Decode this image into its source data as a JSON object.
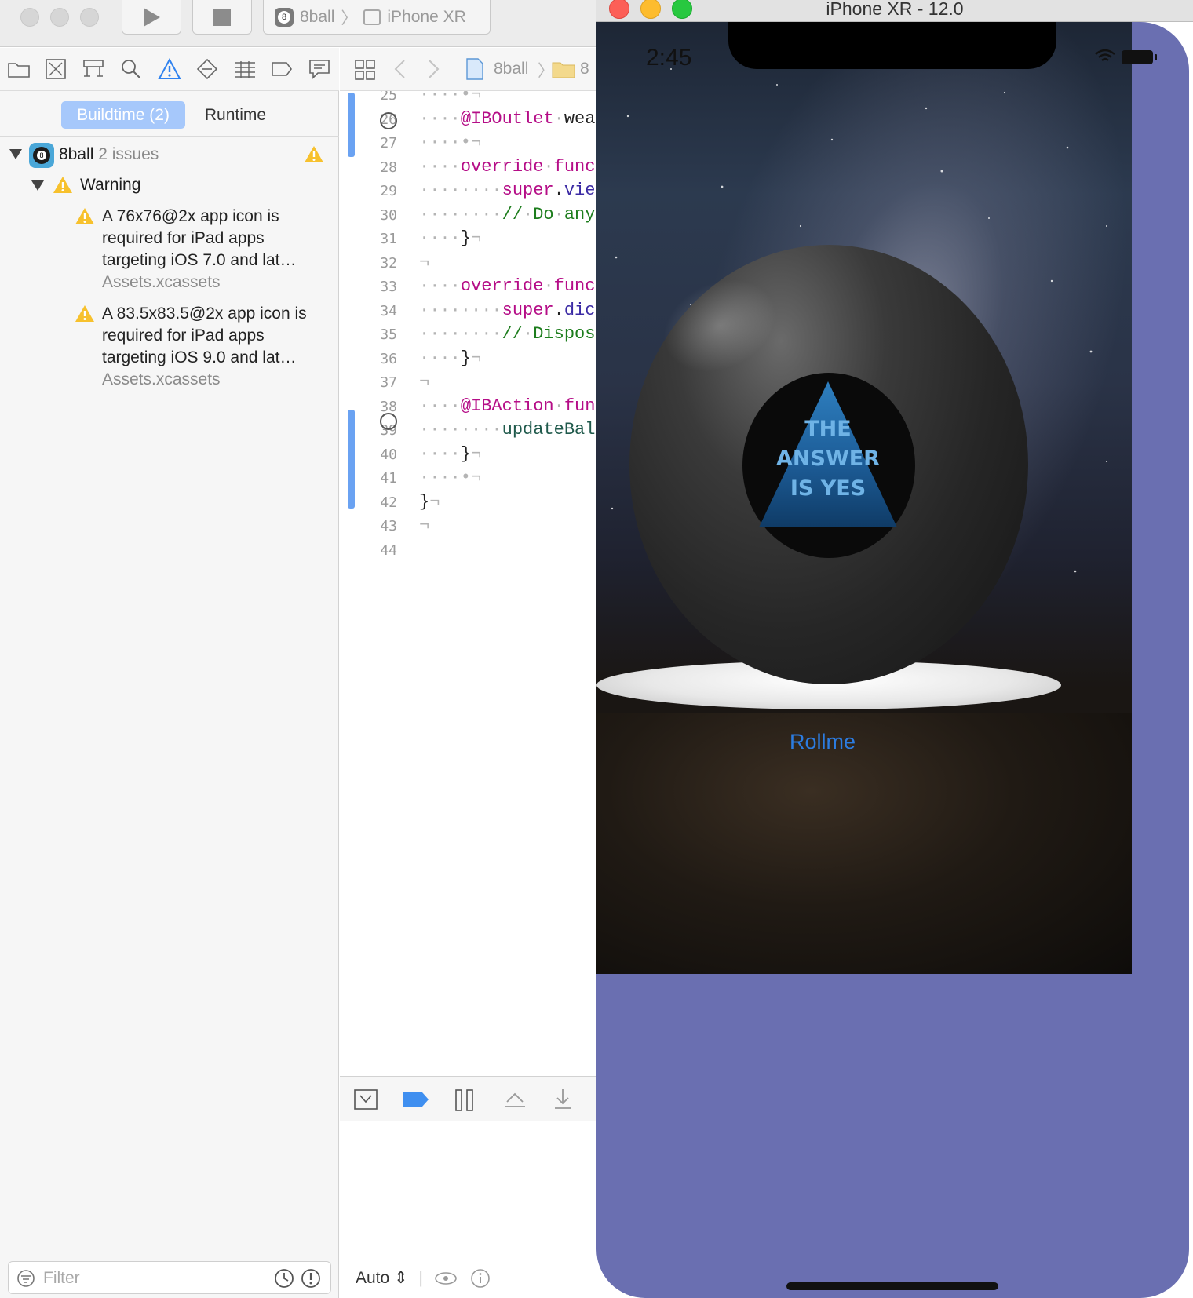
{
  "toolbar": {
    "scheme_project": "8ball",
    "scheme_device": "iPhone XR"
  },
  "navigator": {
    "segments": {
      "active": "Buildtime (2)",
      "inactive": "Runtime"
    },
    "project": {
      "name": "8ball",
      "issue_count": "2 issues"
    },
    "group": "Warning",
    "issues": [
      {
        "text": "A 76x76@2x app icon is required for iPad apps targeting iOS 7.0 and lat…",
        "file": "Assets.xcassets"
      },
      {
        "text": "A 83.5x83.5@2x app icon is required for iPad apps targeting iOS 9.0 and lat…",
        "file": "Assets.xcassets"
      }
    ],
    "filter_placeholder": "Filter"
  },
  "editor": {
    "jump_bar": {
      "project": "8ball",
      "folder": "8"
    },
    "lines": [
      {
        "n": "25",
        "code": "····•¬"
      },
      {
        "n": "26",
        "code": "····@IBOutlet·wea"
      },
      {
        "n": "27",
        "code": "····•¬"
      },
      {
        "n": "28",
        "code": "····override·func"
      },
      {
        "n": "29",
        "code": "········super.vie"
      },
      {
        "n": "30",
        "code": "········//·Do·any"
      },
      {
        "n": "31",
        "code": "····}¬"
      },
      {
        "n": "32",
        "code": "¬"
      },
      {
        "n": "33",
        "code": "····override·func"
      },
      {
        "n": "34",
        "code": "········super.dic"
      },
      {
        "n": "35",
        "code": "········//·Dispos"
      },
      {
        "n": "36",
        "code": "····}¬"
      },
      {
        "n": "37",
        "code": "¬"
      },
      {
        "n": "38",
        "code": "····@IBAction·fun"
      },
      {
        "n": "39",
        "code": "········updateBal"
      },
      {
        "n": "40",
        "code": "····}¬"
      },
      {
        "n": "41",
        "code": "····•¬"
      },
      {
        "n": "42",
        "code": "}¬"
      },
      {
        "n": "43",
        "code": "¬"
      },
      {
        "n": "44",
        "code": ""
      }
    ],
    "debug_footer": "Auto ⇕"
  },
  "simulator": {
    "title": "iPhone XR - 12.0",
    "status_time": "2:45",
    "answer_lines": [
      "THE",
      "ANSWER",
      "IS YES"
    ],
    "button_label": "Rollme",
    "colors": {
      "background": "#6a6fb1",
      "button": "#2c7ce0"
    }
  }
}
